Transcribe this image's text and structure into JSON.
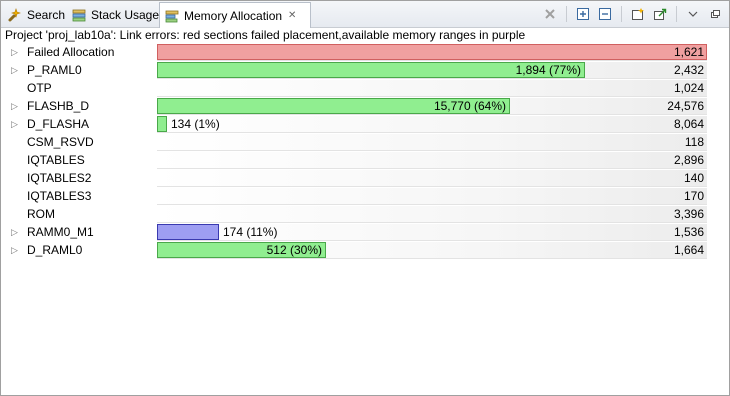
{
  "tabs": [
    {
      "label": "Search",
      "icon": "search-icon",
      "active": false
    },
    {
      "label": "Stack Usage",
      "icon": "stack-usage-icon",
      "active": false
    },
    {
      "label": "Memory Allocation",
      "icon": "memory-allocation-icon",
      "active": true
    }
  ],
  "toolbar": [
    "remove-all-icon",
    "expand-all-icon",
    "collapse-all-icon",
    "new-window-icon",
    "export-icon",
    "view-menu-icon",
    "minimize-icon"
  ],
  "status": "Project 'proj_lab10a': Link errors: red sections failed placement,available memory ranges in purple",
  "colors": {
    "used": "#90ee90",
    "failed": "#f0a0a0",
    "available": "#9e9ef2"
  },
  "rows": [
    {
      "name": "Failed Allocation",
      "expandable": true,
      "bar_fraction": 1.0,
      "bar_color": "red",
      "bar_label": "",
      "total": "1,621"
    },
    {
      "name": "P_RAML0",
      "expandable": true,
      "bar_fraction": 0.779,
      "bar_color": "green",
      "bar_label": "1,894 (77%)",
      "total": "2,432"
    },
    {
      "name": "OTP",
      "expandable": false,
      "bar_fraction": 0,
      "bar_color": "",
      "bar_label": "",
      "total": "1,024"
    },
    {
      "name": "FLASHB_D",
      "expandable": true,
      "bar_fraction": 0.642,
      "bar_color": "green",
      "bar_label": "15,770 (64%)",
      "total": "24,576"
    },
    {
      "name": "D_FLASHA",
      "expandable": true,
      "bar_fraction": 0.0166,
      "bar_color": "green",
      "bar_label": "134 (1%)",
      "total": "8,064"
    },
    {
      "name": "CSM_RSVD",
      "expandable": false,
      "bar_fraction": 0,
      "bar_color": "",
      "bar_label": "",
      "total": "118"
    },
    {
      "name": "IQTABLES",
      "expandable": false,
      "bar_fraction": 0,
      "bar_color": "",
      "bar_label": "",
      "total": "2,896"
    },
    {
      "name": "IQTABLES2",
      "expandable": false,
      "bar_fraction": 0,
      "bar_color": "",
      "bar_label": "",
      "total": "140"
    },
    {
      "name": "IQTABLES3",
      "expandable": false,
      "bar_fraction": 0,
      "bar_color": "",
      "bar_label": "",
      "total": "170"
    },
    {
      "name": "ROM",
      "expandable": false,
      "bar_fraction": 0,
      "bar_color": "",
      "bar_label": "",
      "total": "3,396"
    },
    {
      "name": "RAMM0_M1",
      "expandable": true,
      "bar_fraction": 0.113,
      "bar_color": "purple",
      "bar_label": "174 (11%)",
      "total": "1,536"
    },
    {
      "name": "D_RAML0",
      "expandable": true,
      "bar_fraction": 0.308,
      "bar_color": "green",
      "bar_label": "512 (30%)",
      "total": "1,664"
    }
  ]
}
